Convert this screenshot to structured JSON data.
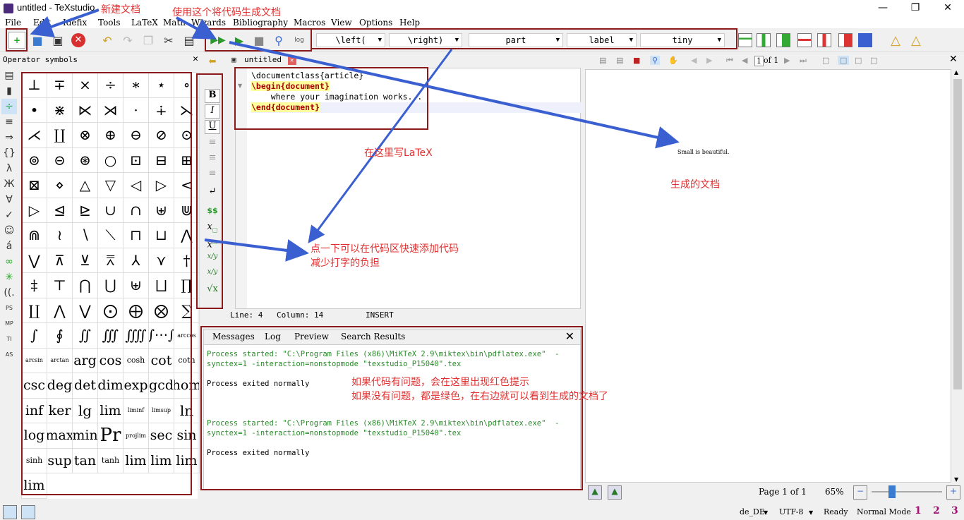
{
  "window": {
    "title": "untitled - TeXstudio"
  },
  "menu": [
    "File",
    "Edit",
    "Idefix",
    "Tools",
    "LaTeX",
    "Math",
    "Wizards",
    "Bibliography",
    "Macros",
    "View",
    "Options",
    "Help"
  ],
  "toolbar": {
    "combos": [
      "\\left(",
      "\\right)",
      "part",
      "label",
      "tiny"
    ]
  },
  "ops": {
    "title": "Operator symbols",
    "cells": [
      "⊥",
      "∓",
      "×",
      "÷",
      "∗",
      "⋆",
      "∘",
      "•",
      "⋇",
      "⋉",
      "⋊",
      "·",
      "∔",
      "⋋",
      "⋌",
      "∐",
      "⊗",
      "⊕",
      "⊖",
      "⊘",
      "⊙",
      "⊚",
      "⊝",
      "⊛",
      "○",
      "⊡",
      "⊟",
      "⊞",
      "⊠",
      "⋄",
      "△",
      "▽",
      "◁",
      "▷",
      "<",
      "▷",
      "⊴",
      "⊵",
      "∪",
      "∩",
      "⊎",
      "⋓",
      "⋒",
      "≀",
      "∖",
      "⟍",
      "⊓",
      "⊔",
      "⋀",
      "⋁",
      "⊼",
      "⊻",
      "⩞",
      "⅄",
      "⋎",
      "†",
      "‡",
      "⊤",
      "⋂",
      "⋃",
      "⊎",
      "⨆",
      "∏",
      "∐",
      "⋀",
      "⋁",
      "⨀",
      "⨁",
      "⨂",
      "∑",
      "∫",
      "∮",
      "∬",
      "∭",
      "⨌",
      "∫⋯∫",
      "arccos",
      "arcsin",
      "arctan",
      "arg",
      "cos",
      "cosh",
      "cot",
      "coth",
      "csc",
      "deg",
      "det",
      "dim",
      "exp",
      "gcd",
      "hom",
      "inf",
      "ker",
      "lg",
      "lim",
      "liminf",
      "limsup",
      "ln",
      "log",
      "max",
      "min",
      "Pr",
      "projlim",
      "sec",
      "sin",
      "sinh",
      "sup",
      "tan",
      "tanh",
      "lim",
      "lim",
      "lim",
      "lim"
    ]
  },
  "editor": {
    "tab": "untitled",
    "lines": [
      "\\documentclass{article}",
      "\\begin{document}",
      "    where your imagination works...",
      "\\end{document}"
    ],
    "status": {
      "line": "Line: 4",
      "column": "Column: 14",
      "mode": "INSERT"
    }
  },
  "messages": {
    "tabs": [
      "Messages",
      "Log",
      "Preview",
      "Search Results"
    ],
    "lines": [
      "Process started: \"C:\\Program Files (x86)\\MiKTeX 2.9\\miktex\\bin\\pdflatex.exe\"  -",
      "synctex=1 -interaction=nonstopmode \"texstudio_P15040\".tex",
      "Process exited normally",
      "Process started: \"C:\\Program Files (x86)\\MiKTeX 2.9\\miktex\\bin\\pdflatex.exe\"  -",
      "synctex=1 -interaction=nonstopmode \"texstudio_P15040\".tex",
      "Process exited normally"
    ]
  },
  "preview": {
    "page": "1",
    "of": "of 1",
    "text": "Small is beautiful.",
    "page_label": "Page 1 of 1",
    "zoom": "65%"
  },
  "statusbar": {
    "lang": "de_DE",
    "encoding": "UTF-8",
    "ready": "Ready",
    "mode": "Normal Mode"
  },
  "annotations": {
    "new_doc": "新建文档",
    "compile": "使用这个将代码生成文档",
    "write_here": "在这里写LaTeX",
    "generated": "生成的文档",
    "click_line1": "点一下可以在代码区快速添加代码",
    "click_line2": "减少打字的负担",
    "error_line1": "如果代码有问题，会在这里出现红色提示",
    "error_line2": "如果没有问题，都是绿色，在右边就可以看到生成的文档了"
  },
  "colors": {
    "annotation": "#e03030",
    "box": "#8b1a1a",
    "arrow": "#3a5fd0",
    "keyword_bg": "#ffff9e",
    "ok_text": "#2a8a2a"
  }
}
